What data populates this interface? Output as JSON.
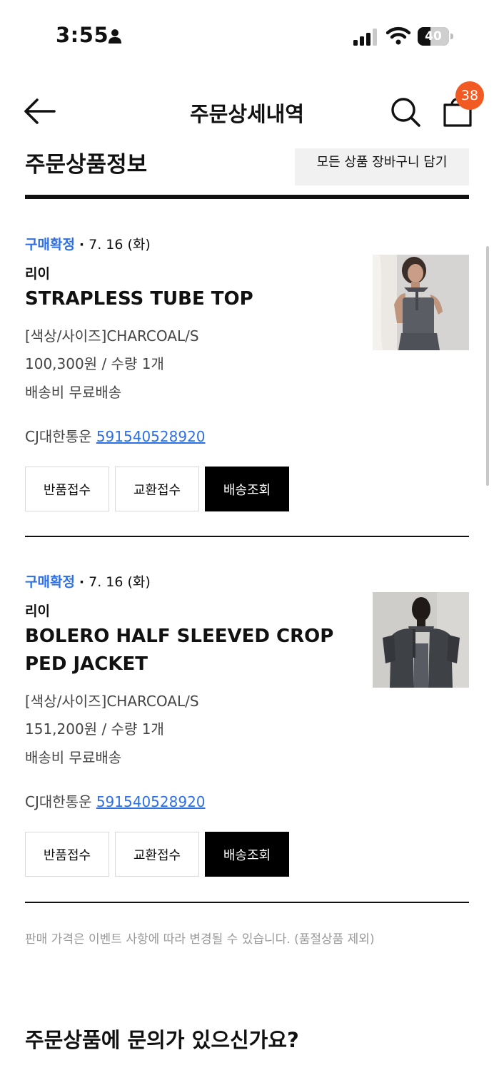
{
  "status_bar": {
    "time": "3:55",
    "battery": "40",
    "battery_level": 0.4
  },
  "header": {
    "title": "주문상세내역",
    "cart_count": "38"
  },
  "section": {
    "title": "주문상품정보",
    "add_all_button": "모든 상품 장바구니 담기"
  },
  "items": [
    {
      "status": "구매확정",
      "separator": "·",
      "date": "7. 16 (화)",
      "brand": "리이",
      "name": "STRAPLESS TUBE TOP",
      "option": "[색상/사이즈]CHARCOAL/S",
      "price_qty": "100,300원 / 수량 1개",
      "shipping": "배송비 무료배송",
      "courier": "CJ대한통운",
      "tracking_number": "591540528920",
      "actions": [
        "반품접수",
        "교환접수",
        "배송조회"
      ]
    },
    {
      "status": "구매확정",
      "separator": "·",
      "date": "7. 16 (화)",
      "brand": "리이",
      "name": "BOLERO HALF SLEEVED CROPPED JACKET",
      "option": "[색상/사이즈]CHARCOAL/S",
      "price_qty": "151,200원 / 수량 1개",
      "shipping": "배송비 무료배송",
      "courier": "CJ대한통운",
      "tracking_number": "591540528920",
      "actions": [
        "반품접수",
        "교환접수",
        "배송조회"
      ]
    }
  ],
  "notice": "판매 가격은 이벤트 사항에 따라 변경될 수 있습니다. (품절상품 제외)",
  "inquiry_title": "주문상품에 문의가 있으신가요?",
  "colors": {
    "status_blue": "#2f6fe4",
    "badge_orange": "#f15a22",
    "solid_button": "#000000"
  }
}
